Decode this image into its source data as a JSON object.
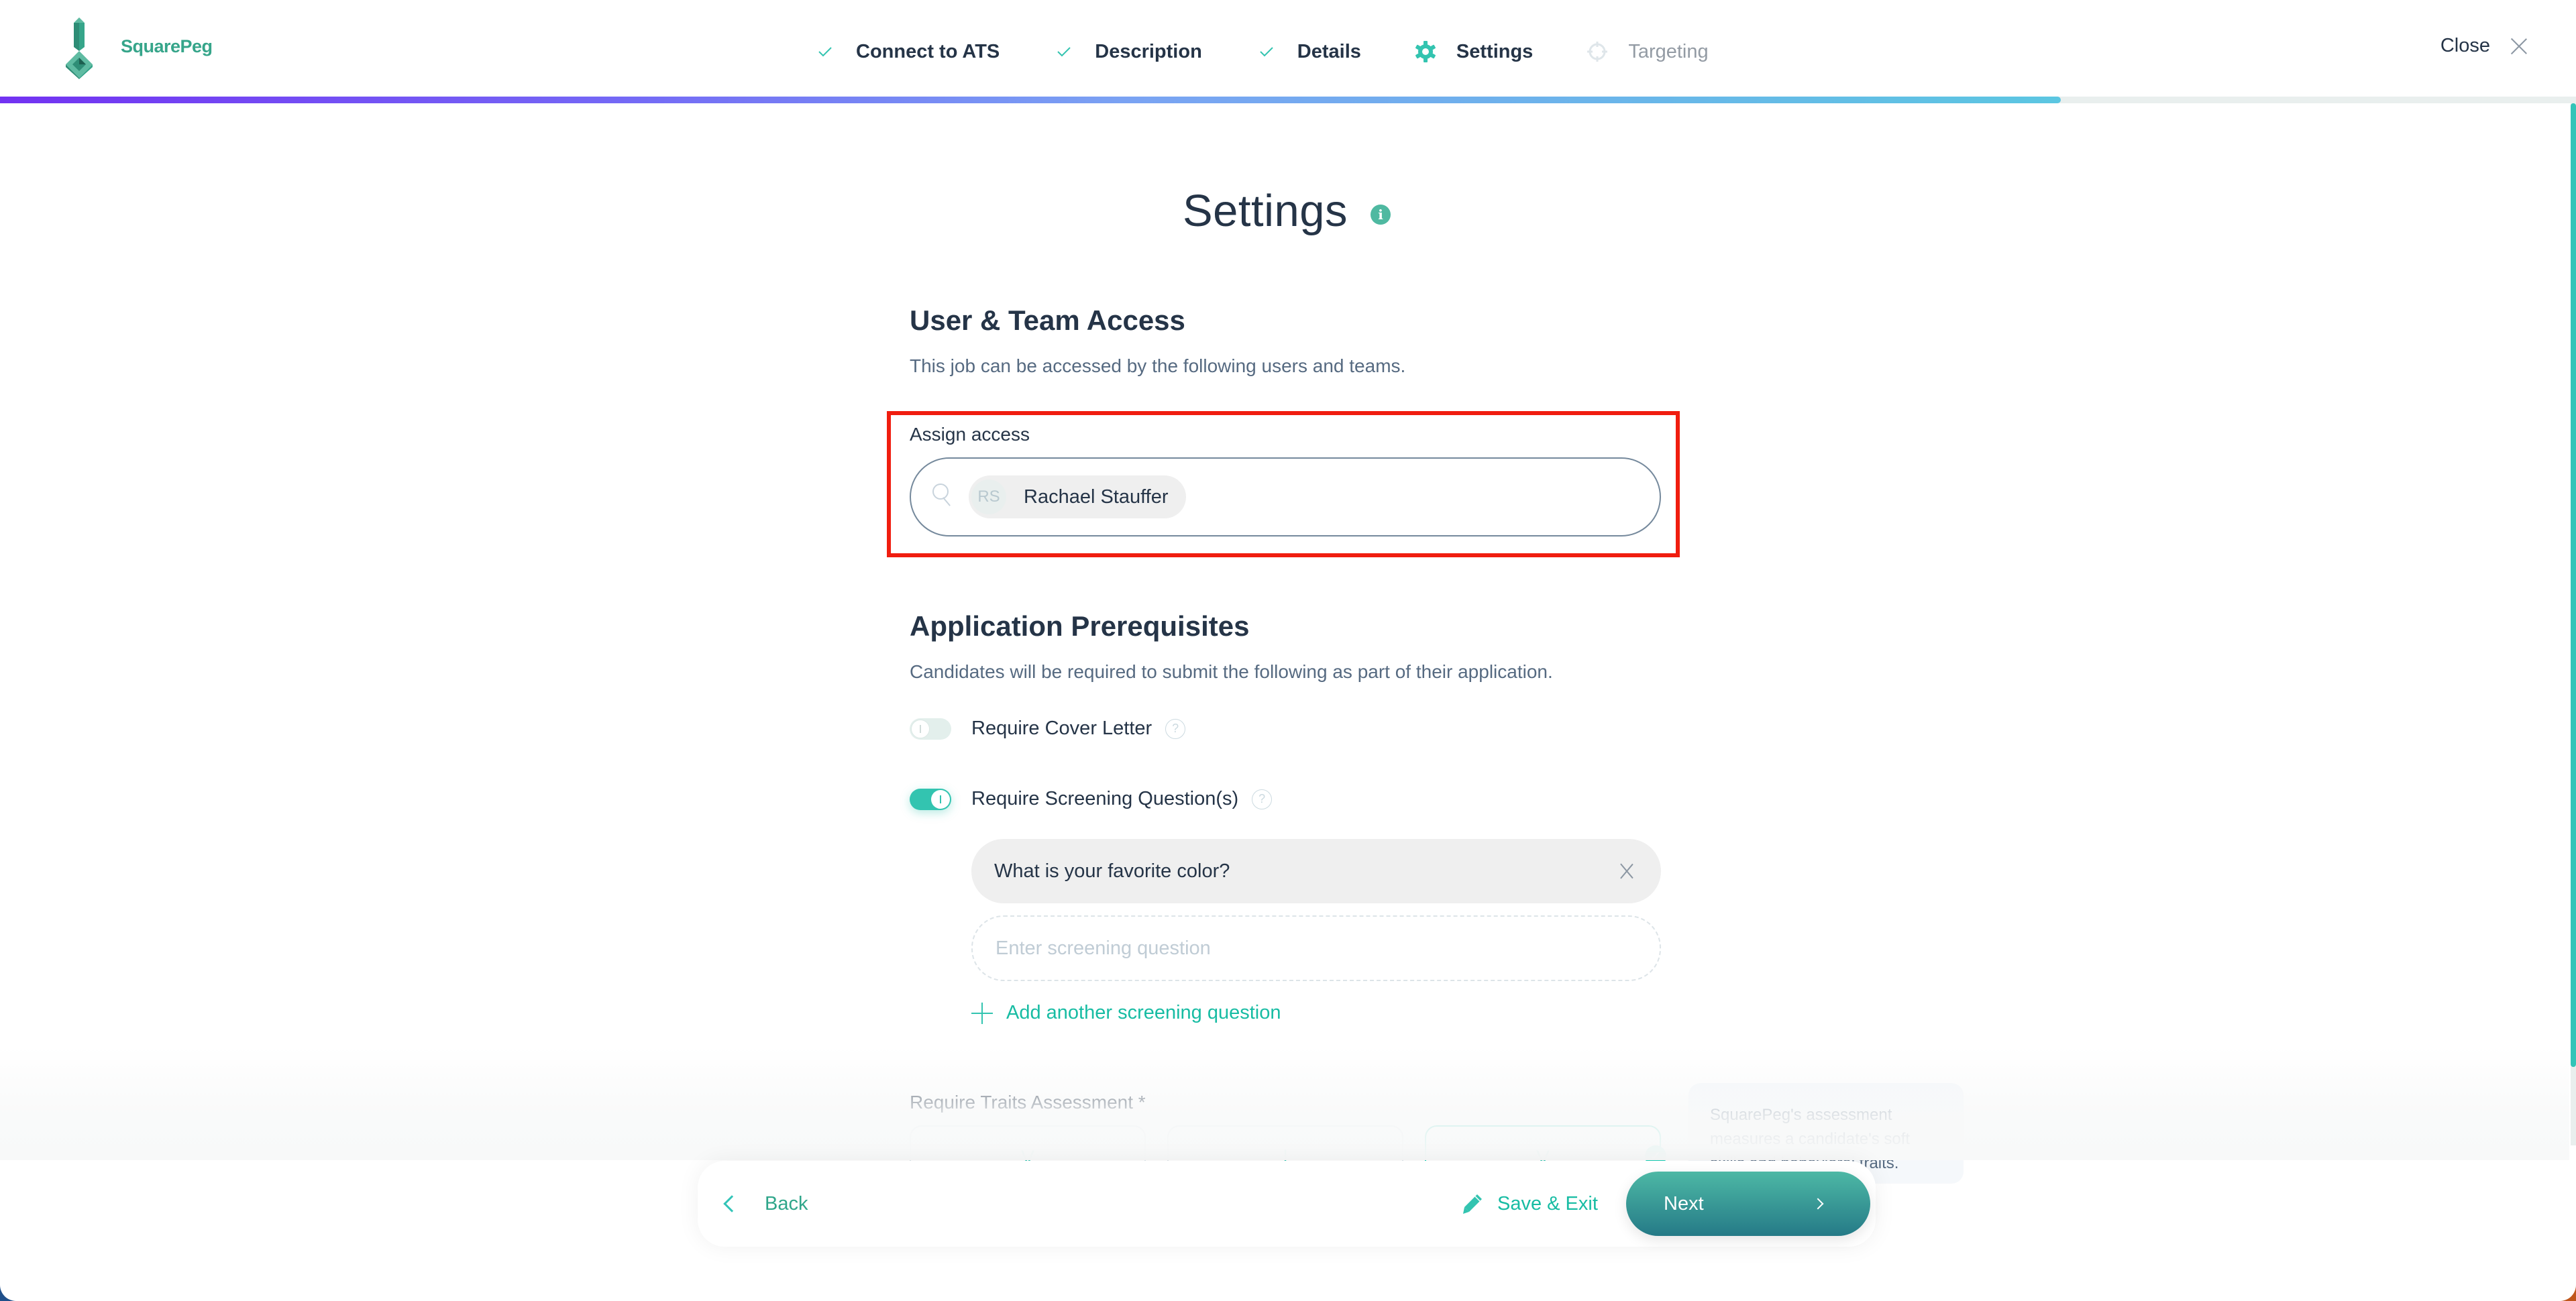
{
  "app": {
    "brand": "SquarePeg",
    "colors": {
      "brand_green": "#36a58a",
      "accent_teal": "#33c4b0",
      "text_dark": "#253447",
      "text_muted": "#566a81",
      "highlight_red": "#f01d0f"
    }
  },
  "header": {
    "steps": [
      {
        "label": "Connect to ATS",
        "status": "completed",
        "icon": "check-icon"
      },
      {
        "label": "Description",
        "status": "completed",
        "icon": "check-icon"
      },
      {
        "label": "Details",
        "status": "completed",
        "icon": "check-icon"
      },
      {
        "label": "Settings",
        "status": "current",
        "icon": "gear-icon"
      },
      {
        "label": "Targeting",
        "status": "upcoming",
        "icon": "crosshair-icon"
      }
    ],
    "close_label": "Close",
    "progress_percent": 80
  },
  "scrollbar": {
    "thumb_start_fraction": 0.0,
    "thumb_size_fraction": 0.925
  },
  "page": {
    "title": "Settings",
    "title_icon": "info-icon"
  },
  "user_team_access": {
    "title": "User & Team Access",
    "description": "This job can be accessed by the following users and teams.",
    "assign_label": "Assign access",
    "assigned": [
      {
        "initials": "RS",
        "name": "Rachael Stauffer"
      }
    ]
  },
  "application_prerequisites": {
    "title": "Application Prerequisites",
    "description": "Candidates will be required to submit the following as part of their application.",
    "toggles": [
      {
        "label": "Require Cover Letter",
        "enabled": false
      },
      {
        "label": "Require Screening Question(s)",
        "enabled": true
      }
    ],
    "screening_questions": [
      "What is your favorite color?"
    ],
    "new_question_placeholder": "Enter screening question",
    "add_question_label": "Add another screening question"
  },
  "traits_assessment": {
    "label": "Require Traits Assessment *",
    "options": [
      {
        "icon": "V",
        "selected": false
      },
      {
        "icon": "|",
        "selected": false
      },
      {
        "icon": "V",
        "selected": true
      }
    ],
    "tip": "SquarePeg's assessment measures a candidate's soft skills and behavioral traits."
  },
  "footer": {
    "back_label": "Back",
    "save_exit_label": "Save & Exit",
    "next_label": "Next"
  }
}
